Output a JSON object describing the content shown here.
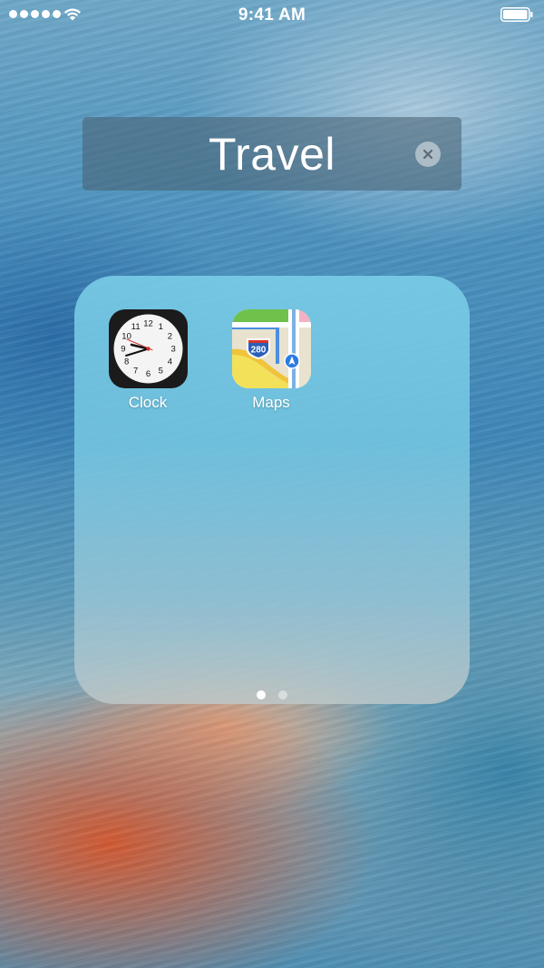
{
  "status_bar": {
    "time": "9:41 AM",
    "signal_bars": 5,
    "icons": [
      "signal-dots-icon",
      "wifi-icon",
      "battery-icon"
    ]
  },
  "folder": {
    "title": "Travel",
    "clear_icon": "clear-text-icon",
    "apps": [
      {
        "label": "Clock",
        "icon": "clock-icon"
      },
      {
        "label": "Maps",
        "icon": "maps-icon"
      }
    ],
    "map_icon": {
      "highway_shield": "280"
    },
    "pages": {
      "count": 2,
      "current": 1
    }
  },
  "clock_face": {
    "numerals": [
      "12",
      "1",
      "2",
      "3",
      "4",
      "5",
      "6",
      "7",
      "8",
      "9",
      "10",
      "11"
    ]
  }
}
